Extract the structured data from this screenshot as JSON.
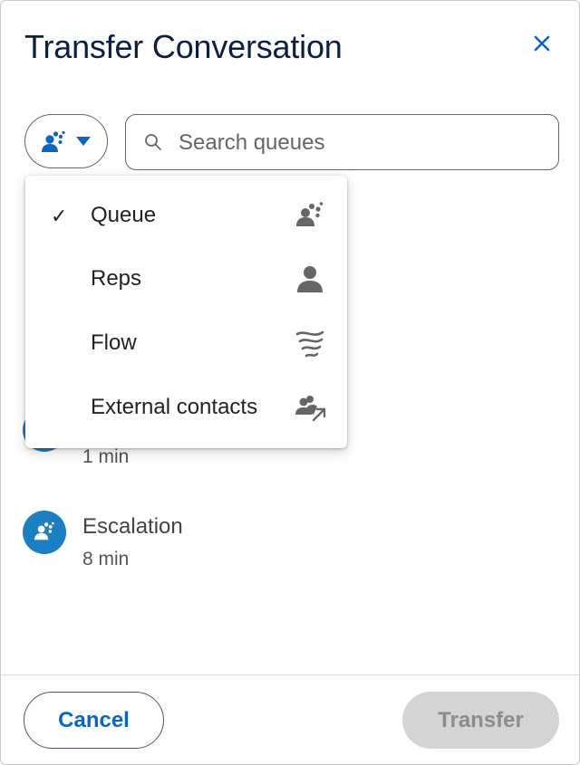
{
  "dialog": {
    "title": "Transfer Conversation"
  },
  "icons": {
    "close": "close-icon",
    "type_selector": "queue-icon",
    "search": "search-icon"
  },
  "search": {
    "placeholder": "Search queues",
    "value": ""
  },
  "type_menu": {
    "items": [
      {
        "label": "Queue",
        "selected": true,
        "check": "✓",
        "icon": "queue-icon"
      },
      {
        "label": "Reps",
        "selected": false,
        "check": "",
        "icon": "person-icon"
      },
      {
        "label": "Flow",
        "selected": false,
        "check": "",
        "icon": "flow-icon"
      },
      {
        "label": "External contacts",
        "selected": false,
        "check": "",
        "icon": "external-contacts-icon"
      }
    ]
  },
  "queues": [
    {
      "name": "",
      "wait": "1 min"
    },
    {
      "name": "Escalation",
      "wait": "8 min"
    }
  ],
  "footer": {
    "cancel_label": "Cancel",
    "transfer_label": "Transfer"
  },
  "colors": {
    "title": "#0b1f44",
    "accent": "#0a66c2",
    "avatar": "#1b7fc1",
    "disabled_bg": "#d4d4d4",
    "disabled_text": "#8c8c8c"
  }
}
